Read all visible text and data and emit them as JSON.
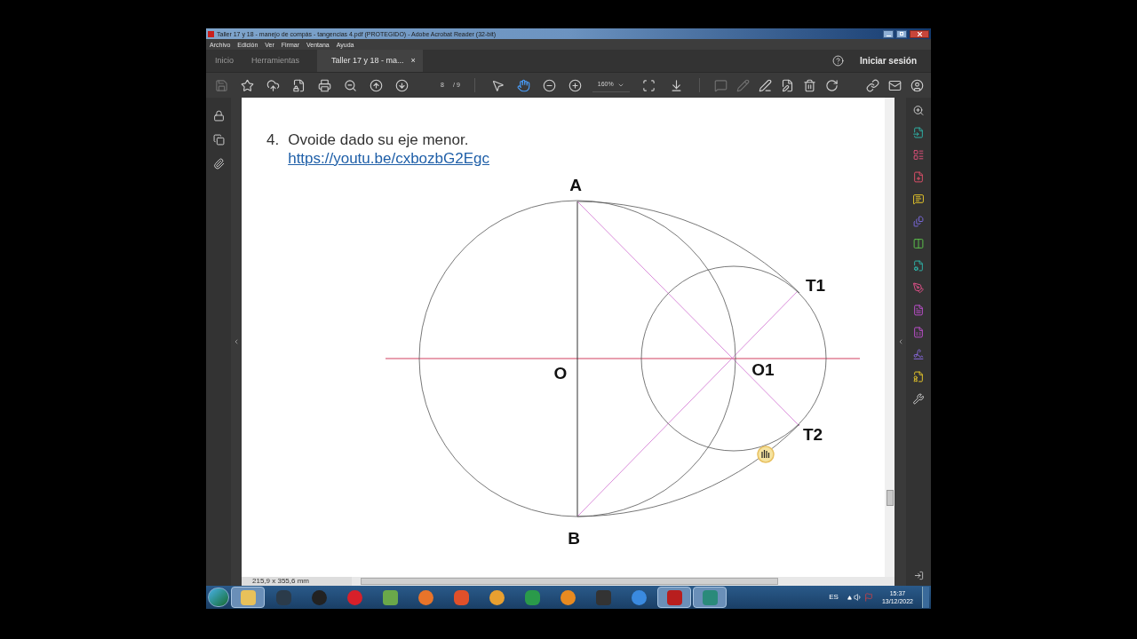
{
  "window": {
    "title": "Taller 17 y 18 - manejo de compás  - tangencias 4.pdf (PROTEGIDO) - Adobe Acrobat Reader (32-bit)"
  },
  "menu": [
    "Archivo",
    "Edición",
    "Ver",
    "Firmar",
    "Ventana",
    "Ayuda"
  ],
  "tabs": [
    {
      "label": "Inicio",
      "selected": false
    },
    {
      "label": "Herramientas",
      "selected": false
    },
    {
      "label": "Taller 17 y 18 - ma...",
      "selected": true,
      "close": "×"
    }
  ],
  "sign_in": "Iniciar sesión",
  "toolbar": {
    "page": "8",
    "page_count": "/ 9",
    "zoom": "160%",
    "tools": [
      {
        "kind": "save",
        "disabled": true
      },
      {
        "kind": "star",
        "disabled": false
      },
      {
        "kind": "upload",
        "disabled": false
      },
      {
        "kind": "protect",
        "disabled": false
      },
      {
        "kind": "print",
        "disabled": false
      },
      {
        "kind": "zoomout",
        "disabled": false
      },
      {
        "kind": "up",
        "disabled": false
      },
      {
        "kind": "down",
        "disabled": false
      }
    ],
    "modes": [
      {
        "kind": "select",
        "selected": false
      },
      {
        "kind": "hand",
        "selected": true
      }
    ]
  },
  "document": {
    "number": "4.",
    "heading": "Ovoide dado su eje menor.",
    "link": "https://youtu.be/cxbozbG2Egc",
    "labels": [
      {
        "kind": "A",
        "text": "A"
      },
      {
        "kind": "O",
        "text": "O"
      },
      {
        "kind": "O1",
        "text": "O1"
      },
      {
        "kind": "T1",
        "text": "T1"
      },
      {
        "kind": "T2",
        "text": "T2"
      },
      {
        "kind": "B",
        "text": "B"
      }
    ]
  },
  "status_bar": {
    "page_size": "215,9 x 355,6 mm"
  },
  "taskbar": {
    "apps": [
      {
        "kind": "explorer",
        "selected": true
      },
      {
        "kind": "nox",
        "selected": false
      },
      {
        "kind": "unity",
        "selected": false
      },
      {
        "kind": "opera",
        "selected": false
      },
      {
        "kind": "notepad",
        "selected": false
      },
      {
        "kind": "firefox",
        "selected": false
      },
      {
        "kind": "brave",
        "selected": false
      },
      {
        "kind": "gear",
        "selected": false
      },
      {
        "kind": "sheet",
        "selected": false
      },
      {
        "kind": "media",
        "selected": false
      },
      {
        "kind": "code",
        "selected": false
      },
      {
        "kind": "chrome",
        "selected": false
      },
      {
        "kind": "acrobat",
        "selected": true
      },
      {
        "kind": "cad",
        "selected": true
      }
    ],
    "language": "ES",
    "time": "15:37",
    "date": "13/12/2022"
  }
}
